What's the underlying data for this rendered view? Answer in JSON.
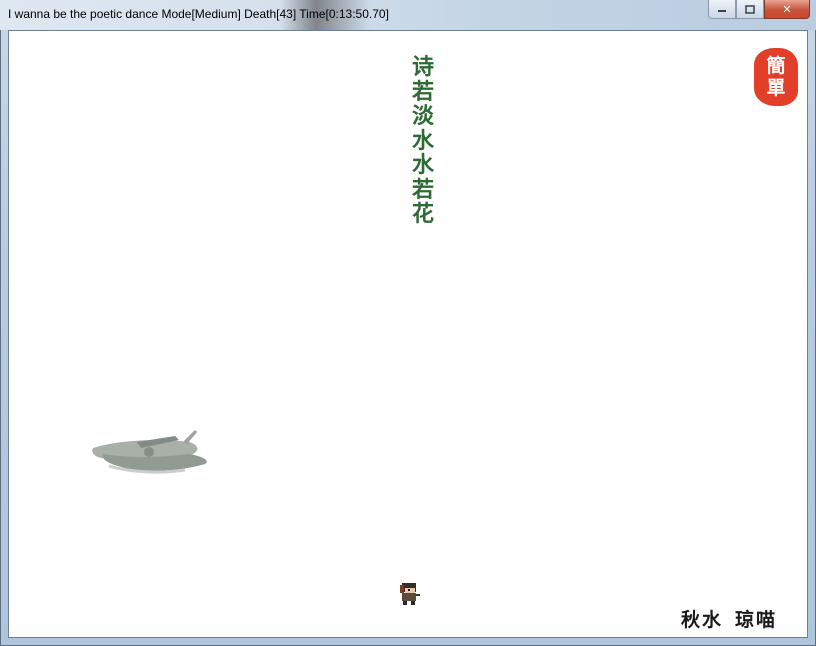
{
  "window": {
    "title": "I wanna be the poetic dance Mode[Medium] Death[43] Time[0:13:50.70]",
    "controls": {
      "minimize_icon": "minimize-icon",
      "maximize_icon": "maximize-icon",
      "close_icon": "close-icon",
      "close_glyph": "✕"
    }
  },
  "scene": {
    "poem_chars": [
      "诗",
      "若",
      "淡",
      "水",
      "水",
      "若",
      "花"
    ],
    "seal": {
      "chars": [
        "簡",
        "單"
      ],
      "color": "#e13f2a"
    },
    "signature": {
      "name_a": "秋水",
      "name_b": "琼喵"
    },
    "poem_color": "#2d6a34",
    "sprites": {
      "boat": "boat-sprite",
      "player": "player-kid-sprite"
    }
  }
}
